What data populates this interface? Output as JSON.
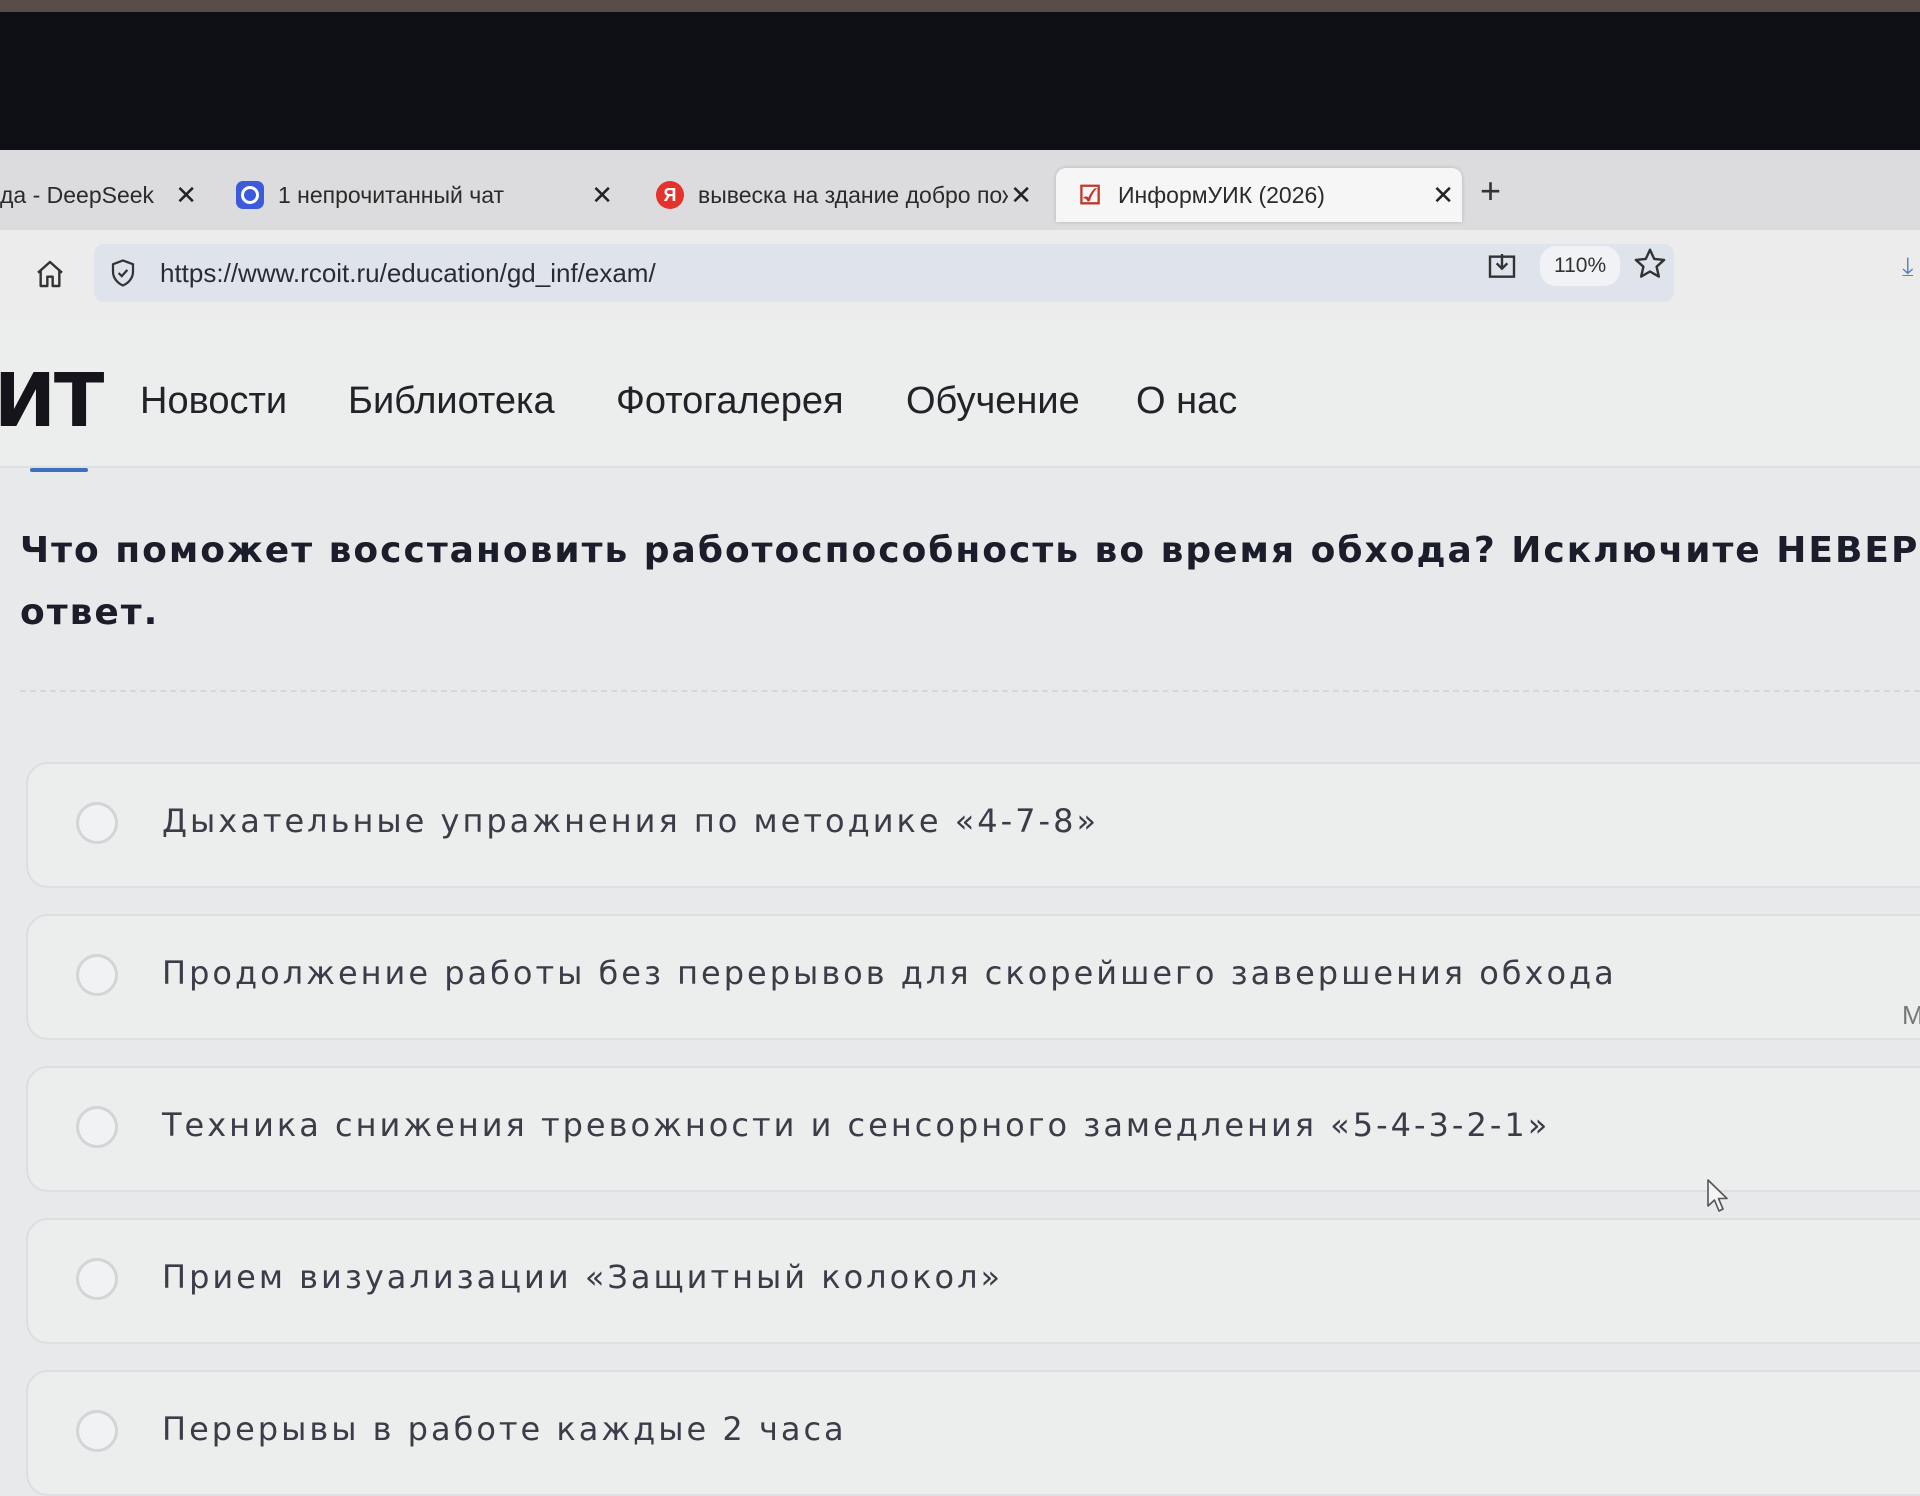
{
  "browser": {
    "tabs": [
      {
        "label": "да - DeepSeek",
        "icon": "deepseek-icon",
        "active": false
      },
      {
        "label": "1 непрочитанный чат",
        "icon": "chat-icon",
        "active": false
      },
      {
        "label": "вывеска на здание добро пож",
        "icon": "yandex-icon",
        "favicon_text": "Я",
        "active": false
      },
      {
        "label": "ИнформУИК (2026)",
        "icon": "checkbox-icon",
        "active": true
      }
    ],
    "close_glyph": "✕",
    "new_tab_glyph": "+",
    "url": "https://www.rcoit.ru/education/gd_inf/exam/",
    "zoom": "110%"
  },
  "site": {
    "logo": "ИТ",
    "nav": [
      "Новости",
      "Библиотека",
      "Фотогалерея",
      "Обучение",
      "О нас"
    ]
  },
  "question": {
    "line1": "Что поможет восстановить работоспособность во время обхода? Исключите НЕВЕРНЫЙ",
    "line2": "ответ."
  },
  "options": [
    {
      "text": "Дыхательные упражнения по методике «4-7-8»",
      "selected": false
    },
    {
      "text": "Продолжение работы без перерывов для скорейшего завершения обхода",
      "selected": false
    },
    {
      "text": "Техника снижения тревожности и сенсорного замедления «5-4-3-2-1»",
      "selected": false
    },
    {
      "text": "Прием визуализации «Защитный колокол»",
      "selected": false
    },
    {
      "text": "Перерывы в работе каждые 2 часа",
      "selected": false
    }
  ],
  "side_mark": "M",
  "colors": {
    "accent": "#3d6fbf",
    "text": "#1b1d2a",
    "option_border": "#dcdee1"
  }
}
